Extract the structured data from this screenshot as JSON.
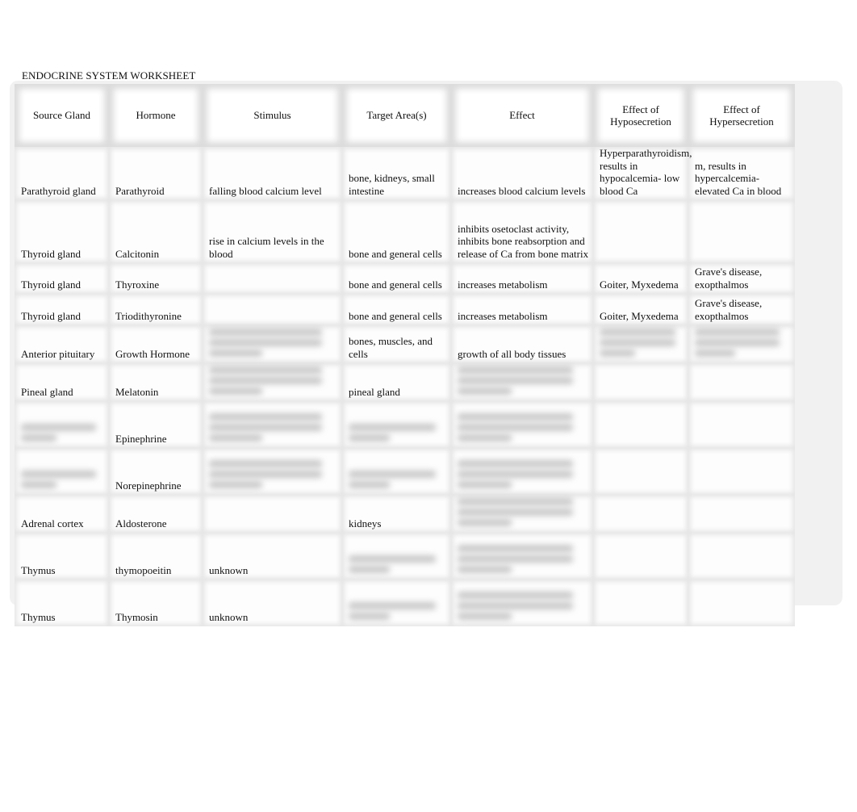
{
  "document": {
    "title": "ENDOCRINE SYSTEM WORKSHEET"
  },
  "table": {
    "headers": [
      "Source Gland",
      "Hormone",
      "Stimulus",
      "Target Area(s)",
      "Effect",
      "Effect of Hyposecretion",
      "Effect of Hypersecretion"
    ],
    "rows": [
      {
        "source_gland": "Parathyroid gland",
        "hormone": "Parathyroid",
        "stimulus": "falling blood calcium level",
        "target": "bone, kidneys, small intestine",
        "effect": "increases blood calcium levels",
        "hyposecretion": "Hyperparathyroidism, results in hypocalcemia- low blood Ca",
        "hypersecretion": "m, results in hypercalcemia- elevated Ca in blood"
      },
      {
        "source_gland": "Thyroid gland",
        "hormone": "Calcitonin",
        "stimulus": "rise in calcium levels in the blood",
        "target": "bone and general cells",
        "effect": "inhibits osetoclast activity, inhibits bone reabsorption and release of Ca from bone matrix",
        "hyposecretion": "",
        "hypersecretion": ""
      },
      {
        "source_gland": "Thyroid gland",
        "hormone": "Thyroxine",
        "stimulus": "",
        "target": "bone and general cells",
        "effect": "increases metabolism",
        "hyposecretion": "Goiter, Myxedema",
        "hypersecretion": "Grave's disease, exopthalmos"
      },
      {
        "source_gland": "Thyroid gland",
        "hormone": "Triodithyronine",
        "stimulus": "",
        "target": "bone and general cells",
        "effect": "increases metabolism",
        "hyposecretion": "Goiter, Myxedema",
        "hypersecretion": "Grave's disease, exopthalmos"
      },
      {
        "source_gland": "Anterior pituitary",
        "hormone": "Growth Hormone",
        "stimulus": "[obscured]",
        "target": "bones, muscles, and cells",
        "effect": "growth of all body tissues",
        "hyposecretion": "[obscured]",
        "hypersecretion": "[obscured]"
      },
      {
        "source_gland": "Pineal gland",
        "hormone": "Melatonin",
        "stimulus": "[obscured]",
        "target": "pineal gland",
        "effect": "[obscured]",
        "hyposecretion": "",
        "hypersecretion": ""
      },
      {
        "source_gland": "[obscured]",
        "hormone": "Epinephrine",
        "stimulus": "[obscured]",
        "target": "[obscured]",
        "effect": "[obscured]",
        "hyposecretion": "",
        "hypersecretion": ""
      },
      {
        "source_gland": "[obscured]",
        "hormone": "Norepinephrine",
        "stimulus": "[obscured]",
        "target": "[obscured]",
        "effect": "[obscured]",
        "hyposecretion": "",
        "hypersecretion": ""
      },
      {
        "source_gland": "Adrenal cortex",
        "hormone": "Aldosterone",
        "stimulus": "",
        "target": "kidneys",
        "effect": "[obscured]",
        "hyposecretion": "",
        "hypersecretion": ""
      },
      {
        "source_gland": "Thymus",
        "hormone": "thymopoeitin",
        "stimulus": "unknown",
        "target": "[obscured]",
        "effect": "[obscured]",
        "hyposecretion": "",
        "hypersecretion": ""
      },
      {
        "source_gland": "Thymus",
        "hormone": "Thymosin",
        "stimulus": "unknown",
        "target": "[obscured]",
        "effect": "[obscured]",
        "hyposecretion": "",
        "hypersecretion": ""
      }
    ]
  }
}
